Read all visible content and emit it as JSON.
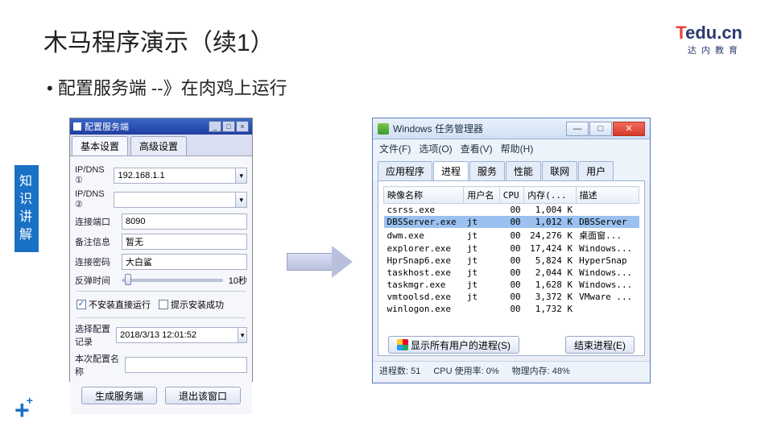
{
  "slide": {
    "title": "木马程序演示（续1）",
    "bullet": "• 配置服务端 --》在肉鸡上运行",
    "sidebar": "知识讲解"
  },
  "logo": {
    "t": "T",
    "edu": "edu.cn",
    "sub": "达内教育"
  },
  "left_app": {
    "title": "配置服务端",
    "tabs": [
      "基本设置",
      "高级设置"
    ],
    "fields": {
      "ipdns1_label": "IP/DNS ①",
      "ipdns1_value": "192.168.1.1",
      "ipdns2_label": "IP/DNS ②",
      "ipdns2_value": "",
      "port_label": "连接端口",
      "port_value": "8090",
      "note_label": "备注信息",
      "note_value": "暂无",
      "pwd_label": "连接密码",
      "pwd_value": "大白鲨",
      "bounce_label": "反弹时间",
      "bounce_suffix": "10秒",
      "chk1": "不安装直接运行",
      "chk2": "提示安装成功",
      "record_label": "选择配置记录",
      "record_value": "2018/3/13 12:01:52",
      "cfgname_label": "本次配置名称",
      "cfgname_value": "",
      "btn_gen": "生成服务端",
      "btn_exit": "退出该窗口"
    }
  },
  "right_app": {
    "title": "Windows 任务管理器",
    "menu": {
      "file": "文件(F)",
      "options": "选项(O)",
      "view": "查看(V)",
      "help": "帮助(H)"
    },
    "tabs": [
      "应用程序",
      "进程",
      "服务",
      "性能",
      "联网",
      "用户"
    ],
    "columns": [
      "映像名称",
      "用户名",
      "CPU",
      "内存(...",
      "描述"
    ],
    "rows": [
      {
        "name": "csrss.exe",
        "user": "",
        "cpu": "00",
        "mem": "1,004 K",
        "desc": ""
      },
      {
        "name": "DBSServer.exe",
        "user": "jt",
        "cpu": "00",
        "mem": "1,012 K",
        "desc": "DBSServer",
        "selected": true
      },
      {
        "name": "dwm.exe",
        "user": "jt",
        "cpu": "00",
        "mem": "24,276 K",
        "desc": "桌面窗..."
      },
      {
        "name": "explorer.exe",
        "user": "jt",
        "cpu": "00",
        "mem": "17,424 K",
        "desc": "Windows..."
      },
      {
        "name": "HprSnap6.exe",
        "user": "jt",
        "cpu": "00",
        "mem": "5,824 K",
        "desc": "HyperSnap"
      },
      {
        "name": "taskhost.exe",
        "user": "jt",
        "cpu": "00",
        "mem": "2,044 K",
        "desc": "Windows..."
      },
      {
        "name": "taskmgr.exe",
        "user": "jt",
        "cpu": "00",
        "mem": "1,628 K",
        "desc": "Windows..."
      },
      {
        "name": "vmtoolsd.exe",
        "user": "jt",
        "cpu": "00",
        "mem": "3,372 K",
        "desc": "VMware ..."
      },
      {
        "name": "winlogon.exe",
        "user": "",
        "cpu": "00",
        "mem": "1,732 K",
        "desc": ""
      }
    ],
    "btn_show_all": "显示所有用户的进程(S)",
    "btn_end": "结束进程(E)",
    "status": {
      "procs": "进程数: 51",
      "cpu": "CPU 使用率: 0%",
      "mem": "物理内存: 48%"
    }
  }
}
